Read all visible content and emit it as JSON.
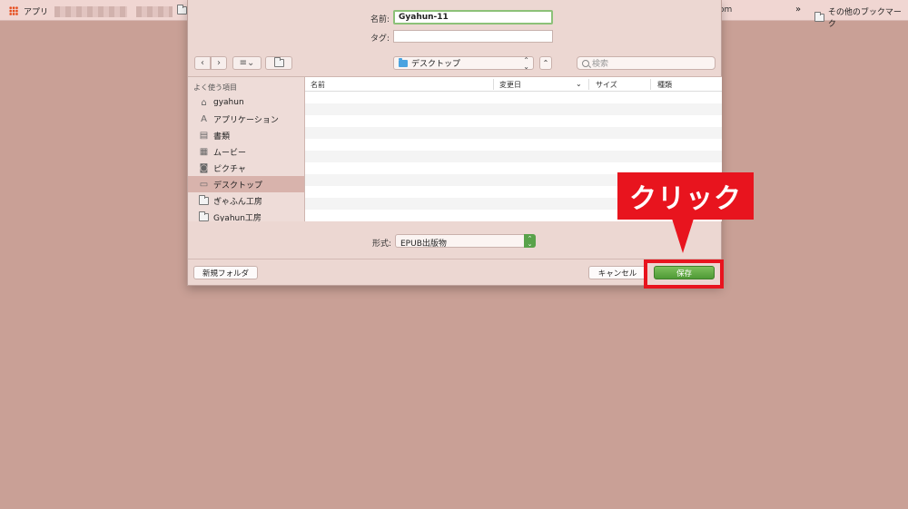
{
  "bookmarks_bar": {
    "apps_label": "アプリ",
    "partial_label": "om",
    "more_symbol": "»",
    "other_bookmarks": "その他のブックマーク"
  },
  "dialog": {
    "name_label": "名前:",
    "name_value": "Gyahun-11",
    "tags_label": "タグ:",
    "tags_value": "",
    "toolbar": {
      "back_icon": "‹",
      "forward_icon": "›",
      "view_icon": "≡⌄",
      "location": "デスクトップ",
      "location_arrows": "⌃⌄",
      "collapse_icon": "⌃",
      "search_placeholder": "検索"
    },
    "sidebar": {
      "heading": "よく使う項目",
      "items": [
        {
          "label": "gyahun",
          "icon": "home-icon",
          "glyph": "⌂",
          "selected": false
        },
        {
          "label": "アプリケーション",
          "icon": "applications-icon",
          "glyph": "A",
          "selected": false
        },
        {
          "label": "書類",
          "icon": "documents-icon",
          "glyph": "▤",
          "selected": false
        },
        {
          "label": "ムービー",
          "icon": "movies-icon",
          "glyph": "▦",
          "selected": false
        },
        {
          "label": "ピクチャ",
          "icon": "camera-icon",
          "glyph": "◙",
          "selected": false
        },
        {
          "label": "デスクトップ",
          "icon": "desktop-icon",
          "glyph": "▭",
          "selected": true
        },
        {
          "label": "ぎゃふん工房",
          "icon": "folder-icon",
          "glyph": "",
          "selected": false
        },
        {
          "label": "Gyahun工房",
          "icon": "folder-icon",
          "glyph": "",
          "selected": false
        }
      ]
    },
    "file_list": {
      "columns": [
        "名前",
        "変更日",
        "サイズ",
        "種類"
      ],
      "sort_indicator": "⌄"
    },
    "format_label": "形式:",
    "format_value": "EPUB出版物",
    "new_folder_button": "新規フォルダ",
    "cancel_button": "キャンセル",
    "save_button": "保存"
  },
  "annotation": {
    "callout_text": "クリック",
    "color": "#e8141e"
  }
}
